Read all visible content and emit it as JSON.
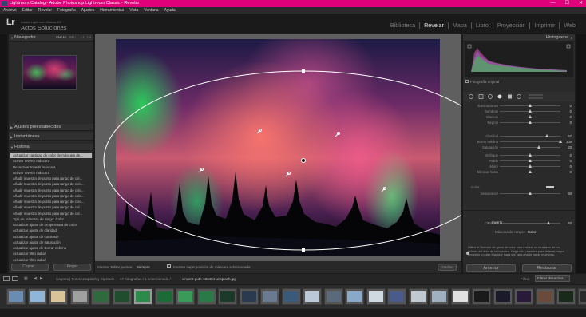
{
  "window": {
    "title": "Lightroom Catalog - Adobe Photoshop Lightroom Classic - Revelar",
    "controls": [
      "—",
      "☐",
      "✕"
    ]
  },
  "menu": [
    "Archivo",
    "Editar",
    "Revelar",
    "Fotografía",
    "Ajustes",
    "Herramientas",
    "Vista",
    "Ventana",
    "Ayuda"
  ],
  "identity": {
    "logo": "Lr",
    "catalog": "Adobe Lightroom Classic CC",
    "org": "Actos Soluciones"
  },
  "modules": [
    {
      "label": "Biblioteca",
      "active": false
    },
    {
      "label": "Revelar",
      "active": true
    },
    {
      "label": "Mapa",
      "active": false
    },
    {
      "label": "Libro",
      "active": false
    },
    {
      "label": "Proyección",
      "active": false
    },
    {
      "label": "Imprimir",
      "active": false
    },
    {
      "label": "Web",
      "active": false
    }
  ],
  "left_panel": {
    "navigator": {
      "title": "Navegador",
      "options": [
        "ENCAJ.",
        "RELL.",
        "1:1",
        "1:4"
      ]
    },
    "presets": "Ajustes preestablecidos",
    "snapshots": "Instantáneas",
    "history_title": "Historia",
    "history": [
      "Actualizar cantidad de color de máscara de...",
      "Activar Invertir máscara",
      "Desactivar Invertir máscara",
      "Activar Invertir máscara",
      "Añadir muestra de punto para rango de col...",
      "Añadir muestra de punto para rango de colo...",
      "Añadir muestra de punto para rango de colo...",
      "Añadir muestra de punto para rango de colo...",
      "Añadir muestra de punto para rango de colo...",
      "Añadir muestra de punto para rango de col...",
      "Añadir muestra de punto para rango de col...",
      "Tipo de máscara de rango: Color",
      "Actualizar ajuste de temperatura de color",
      "Actualizar ajuste de claridad",
      "Actualizar ajuste de contraste",
      "Actualizar ajuste de saturación",
      "Actualizar ajuste de Borrar neblina",
      "Actualizar filtro radial",
      "Actualizar filtro radial",
      "Actualizar filtro radial"
    ],
    "copy_btn": "Copiar...",
    "paste_btn": "Pegar"
  },
  "toolbar": {
    "show_pins_label": "Mostrar Editar puntos:",
    "show_pins_value": "Siempre",
    "overlay_label": "Mostrar superposición de máscara seleccionada",
    "done": "Hecho"
  },
  "right_panel": {
    "histogram_title": "Histograma",
    "original_photo": "Fotografía original",
    "sliders_top": [
      {
        "label": "Iluminaciones",
        "pos": 0.5,
        "val": "0"
      },
      {
        "label": "Sombras",
        "pos": 0.5,
        "val": "0"
      },
      {
        "label": "Blancos",
        "pos": 0.5,
        "val": "0"
      },
      {
        "label": "Negros",
        "pos": 0.5,
        "val": "0"
      },
      {
        "label": "Claridad",
        "pos": 0.78,
        "val": "57"
      },
      {
        "label": "Borrar neblina",
        "pos": 1.0,
        "val": "100"
      },
      {
        "label": "Saturación",
        "pos": 0.65,
        "val": "33"
      },
      {
        "label": "Enfoque",
        "pos": 0.5,
        "val": "0"
      },
      {
        "label": "Ruido",
        "pos": 0.5,
        "val": "0"
      },
      {
        "label": "Moiré",
        "pos": 0.5,
        "val": "0"
      },
      {
        "label": "Eliminar halos",
        "pos": 0.5,
        "val": "0"
      }
    ],
    "color_label": "Color",
    "feather": {
      "label": "Desvanecer",
      "pos": 0.5,
      "val": "50"
    },
    "invert_label": "Invertir",
    "range_mask": {
      "label": "Máscara de rango:",
      "value": "Color"
    },
    "amount": {
      "label": "Cantidad",
      "pos": 0.8,
      "val": "40"
    },
    "help_text": "Utilice el Selector de gama de color para realizar un muestreo de los colores del área de la máscara. Haga clic y arrastre para obtener mayor precisión o pulse Mayús y haga clic para añadir varias muestras.",
    "reset": "Restaurar",
    "close": "Cerrar",
    "prev_btn": "Anterior",
    "restore_btn": "Restaurar"
  },
  "filmstrip_bar": {
    "path": "Carpeta | Fotos Unsplash y Bigstock",
    "count": "67 fotografías / 1 seleccionada /",
    "file": "vincent-guth-183404-unsplash.jpg",
    "filter_label": "Filtro :",
    "filter_value": "Filtros desactiva..."
  },
  "filmstrip_colors": [
    "#6a8cb0",
    "#8fb6d8",
    "#d9c49a",
    "#a0a0a0",
    "#2f6a3f",
    "#1f4d2d",
    "#2e8a4a",
    "#1c6a36",
    "#3a9a5a",
    "#2a7a48",
    "#1b3a2a",
    "#2c3a4f",
    "#6a7a90",
    "#3a5a7a",
    "#bac8d8",
    "#5a6a7a",
    "#8aa8c8",
    "#d0d8e0",
    "#4a5a8a",
    "#c0c8d0",
    "#a0b0c0",
    "#e0e0e0",
    "#1a1a1a",
    "#1a1a2a",
    "#2a1a3a",
    "#6a4a3a",
    "#1a2a1a",
    "#2a2a2a"
  ],
  "colors": {
    "title_bar": "#e0007a",
    "active_module": "#ededed"
  }
}
